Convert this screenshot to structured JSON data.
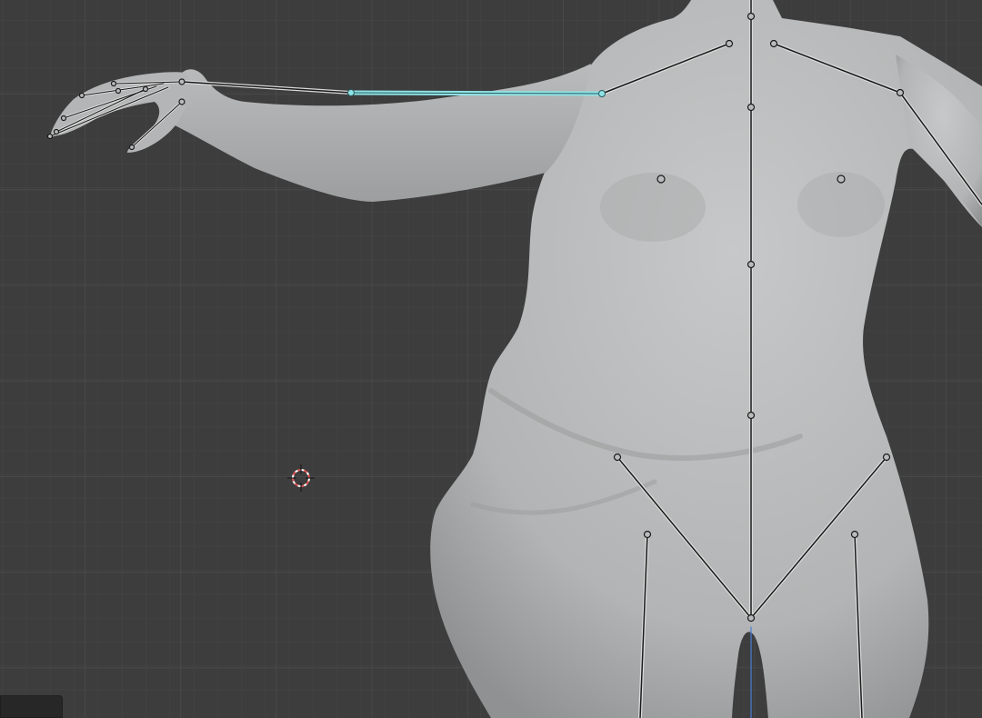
{
  "viewport": {
    "background": "#3d3d3d",
    "grid_minor": "#454545",
    "grid_major": "#4f4f4f",
    "mesh_color": "#b9bbbc",
    "mesh_shadow": "#8e9091",
    "bone_color": "#1a1a1a",
    "bone_outline": "#d9d9d9",
    "selected_bone_color": "#8fe3e6",
    "cursor_colors": [
      "#e05050",
      "#ffffff"
    ],
    "z_axis_color": "#4a7fd6"
  },
  "icons": {
    "cursor": "3d-cursor-icon"
  }
}
